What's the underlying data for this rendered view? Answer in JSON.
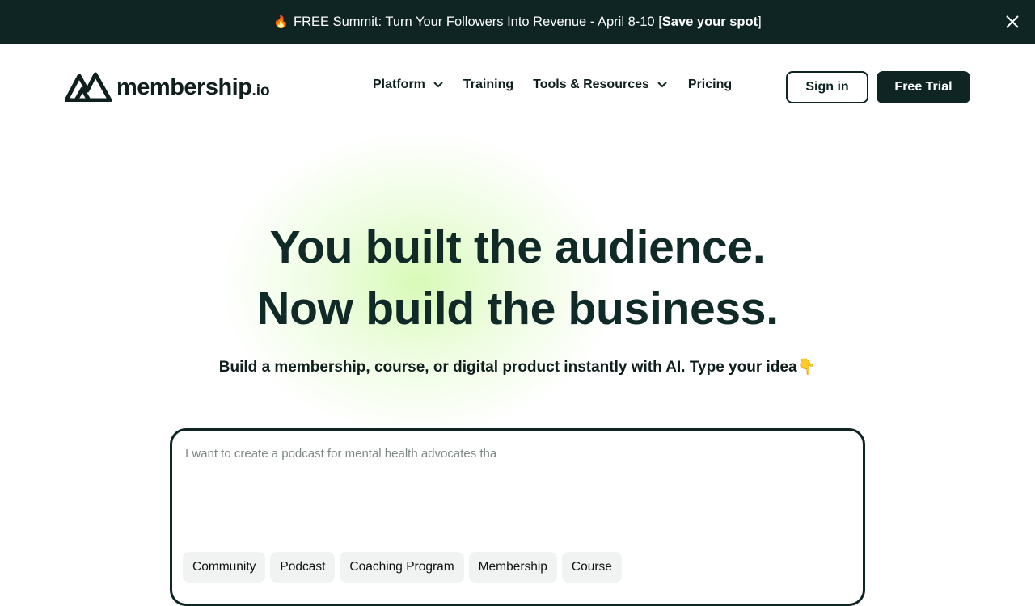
{
  "banner": {
    "emoji": "🔥",
    "text": "FREE Summit: Turn Your Followers Into Revenue - April 8-10",
    "link_open": "[",
    "link_label": "Save your spot",
    "link_close": "]",
    "close_icon": "close-icon"
  },
  "nav": {
    "logo_word": "membership",
    "logo_tld": ".io",
    "items": [
      {
        "label": "Platform",
        "has_dropdown": true
      },
      {
        "label": "Training",
        "has_dropdown": false
      },
      {
        "label": "Tools & Resources",
        "has_dropdown": true
      },
      {
        "label": "Pricing",
        "has_dropdown": false
      }
    ],
    "sign_in": "Sign in",
    "free_trial": "Free Trial"
  },
  "hero": {
    "title_line1": "You built the audience.",
    "title_line2": "Now build the business.",
    "subtitle": "Build a membership, course, or digital product instantly with AI. Type your idea",
    "subtitle_emoji": "👇"
  },
  "prompt": {
    "placeholder": "I want to create a podcast for mental health advocates tha",
    "chips": [
      "Community",
      "Podcast",
      "Coaching Program",
      "Membership",
      "Course"
    ]
  },
  "colors": {
    "brand_dark": "#0e2523",
    "glow": "#d6fab4"
  }
}
